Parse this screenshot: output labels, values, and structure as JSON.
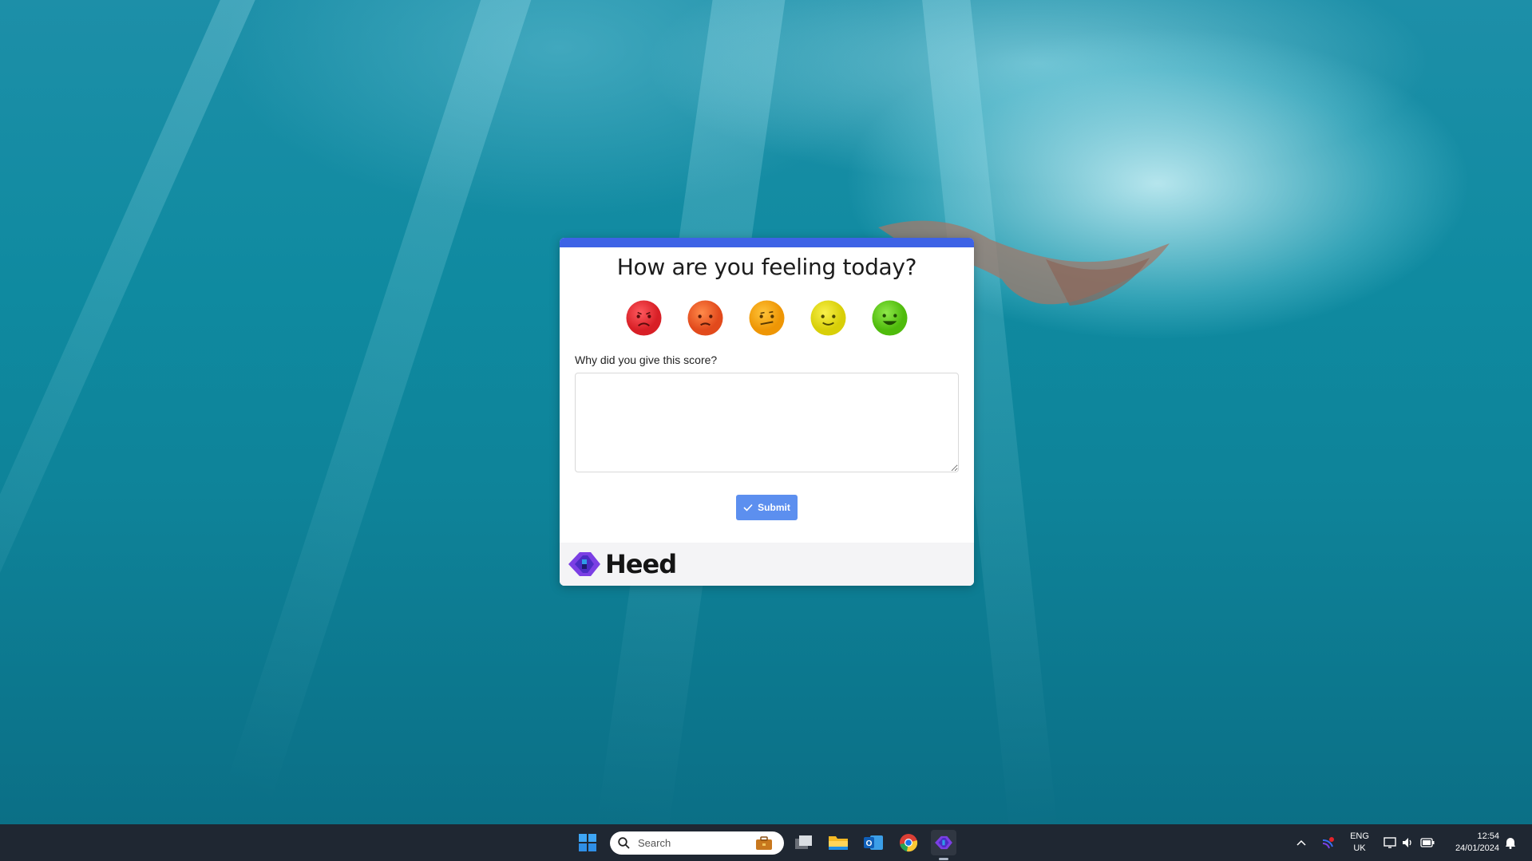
{
  "survey": {
    "title": "How are you feeling today?",
    "ratings": [
      {
        "name": "very-unhappy",
        "color": "#e82f35"
      },
      {
        "name": "unhappy",
        "color": "#ec5a2a"
      },
      {
        "name": "neutral",
        "color": "#f3a215"
      },
      {
        "name": "happy",
        "color": "#e6de12"
      },
      {
        "name": "very-happy",
        "color": "#63cc17"
      }
    ],
    "question": "Why did you give this score?",
    "answer_value": "",
    "submit_label": "Submit",
    "accent": "#3d63e6"
  },
  "brand": {
    "name": "Heed"
  },
  "taskbar": {
    "search_placeholder": "Search",
    "apps": [
      "start-icon",
      "briefcase-icon",
      "task-view-icon",
      "file-explorer-icon",
      "outlook-icon",
      "chrome-icon",
      "heed-app-icon"
    ],
    "language": "ENG",
    "region": "UK",
    "time": "12:54",
    "date": "24/01/2024"
  }
}
